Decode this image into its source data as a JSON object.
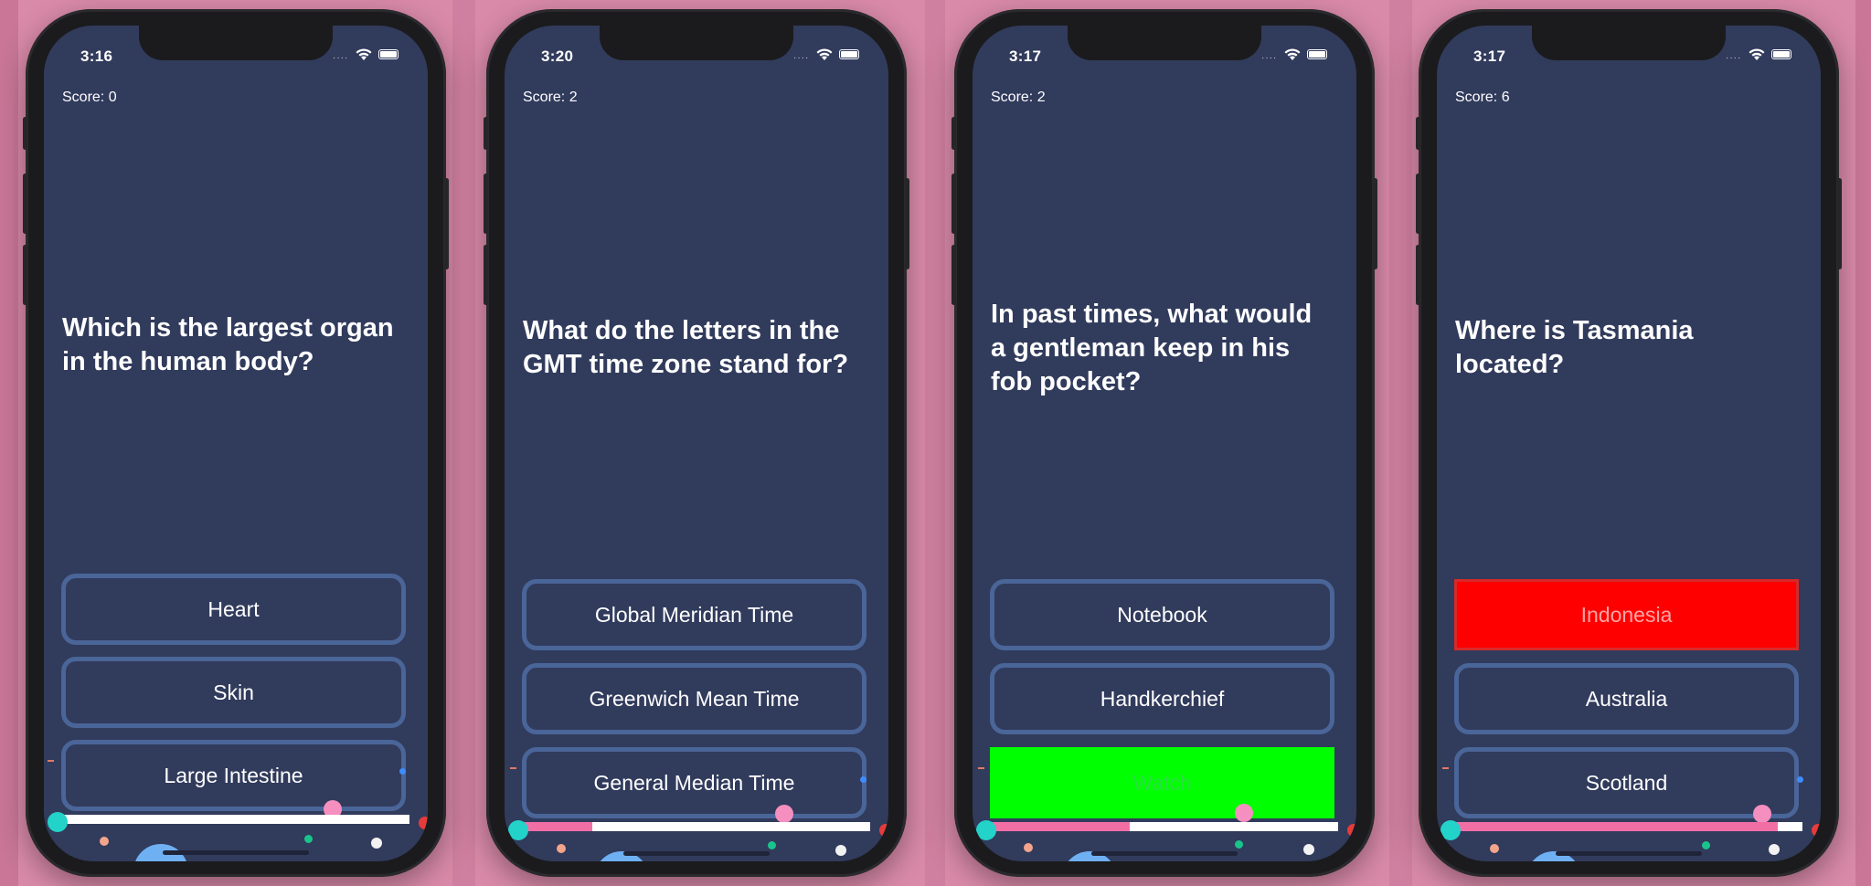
{
  "colors": {
    "background": "#d98aa8",
    "screen": "#313b5c",
    "button_border": "#4a6598",
    "progress_track": "#ffffff",
    "progress_fill": "#f26fa6",
    "correct": "#00ff00",
    "wrong": "#ff0000"
  },
  "phones": [
    {
      "time": "3:16",
      "score": "Score: 0",
      "question": "Which is the largest organ in the human body?",
      "answers": [
        "Heart",
        "Skin",
        "Large Intestine"
      ],
      "answer_states": [
        "default",
        "default",
        "default"
      ],
      "progress": 0.0
    },
    {
      "time": "3:20",
      "score": "Score: 2",
      "question": "What do the letters in the GMT time zone stand for?",
      "answers": [
        "Global Meridian Time",
        "Greenwich Mean Time",
        "General Median Time"
      ],
      "answer_states": [
        "default",
        "default",
        "default"
      ],
      "progress": 0.2
    },
    {
      "time": "3:17",
      "score": "Score: 2",
      "question": "In past times, what would a gentleman keep in his fob pocket?",
      "answers": [
        "Notebook",
        "Handkerchief",
        "Watch"
      ],
      "answer_states": [
        "default",
        "default",
        "correct"
      ],
      "progress": 0.4
    },
    {
      "time": "3:17",
      "score": "Score: 6",
      "question": "Where is Tasmania located?",
      "answers": [
        "Indonesia",
        "Australia",
        "Scotland"
      ],
      "answer_states": [
        "wrong",
        "default",
        "default"
      ],
      "progress": 0.93
    }
  ]
}
